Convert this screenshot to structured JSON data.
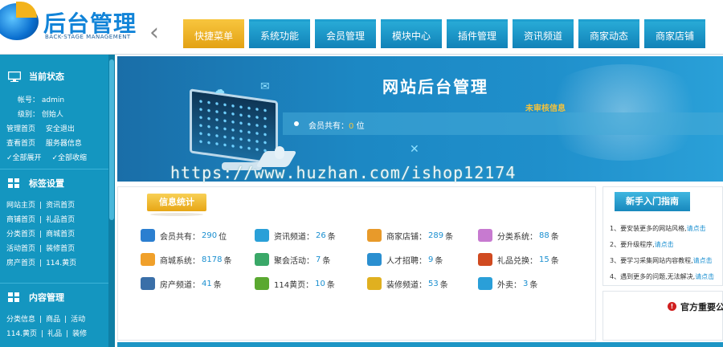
{
  "logo": {
    "title": "后台管理",
    "subtitle": "BACK-STAGE MANAGEMENT"
  },
  "header": {
    "back_glyph": "‹"
  },
  "nav": {
    "tabs": [
      {
        "label": "快捷菜单",
        "active": true
      },
      {
        "label": "系统功能"
      },
      {
        "label": "会员管理"
      },
      {
        "label": "模块中心"
      },
      {
        "label": "插件管理"
      },
      {
        "label": "资讯频道"
      },
      {
        "label": "商家动态"
      },
      {
        "label": "商家店铺"
      }
    ]
  },
  "sidebar": {
    "status": {
      "title": "当前状态",
      "account_label": "帐号：",
      "account": "admin",
      "level_label": "级别：",
      "level": "创始人",
      "links1": [
        "管理首页",
        "安全退出"
      ],
      "links2": [
        "查看首页",
        "服务器信息"
      ],
      "links3": [
        "全部展开",
        "全部收缩"
      ]
    },
    "tags": {
      "title": "标签设置",
      "rows": [
        [
          "网站主页",
          "资讯首页"
        ],
        [
          "商铺首页",
          "礼品首页"
        ],
        [
          "分类首页",
          "商城首页"
        ],
        [
          "活动首页",
          "装修首页"
        ],
        [
          "房产首页",
          "114.黄页"
        ]
      ]
    },
    "content": {
      "title": "内容管理",
      "rows": [
        [
          "分类信息",
          "商品",
          "活动"
        ],
        [
          "114.黄页",
          "礼品",
          "装修"
        ]
      ]
    }
  },
  "banner": {
    "title": "网站后台管理",
    "unaudited": "未审核信息",
    "members_label": "会员共有：",
    "members_value": "0",
    "members_unit": "位"
  },
  "watermark": "https://www.huzhan.com/ishop12174",
  "info": {
    "title": "信息统计",
    "stats": [
      {
        "label": "会员共有：",
        "value": "290",
        "unit": "位",
        "icon": "toggle-icon",
        "color": "#2b7fd0"
      },
      {
        "label": "资讯频道：",
        "value": "26",
        "unit": "条",
        "icon": "globe-icon",
        "color": "#2aa0d8"
      },
      {
        "label": "商家店铺：",
        "value": "289",
        "unit": "条",
        "icon": "book-icon",
        "color": "#e89a2a"
      },
      {
        "label": "分类系统：",
        "value": "88",
        "unit": "条",
        "icon": "flower-icon",
        "color": "#c77ad0"
      },
      {
        "label": "商城系统：",
        "value": "8178",
        "unit": "条",
        "icon": "shop-icon",
        "color": "#f0a02a"
      },
      {
        "label": "聚会活动：",
        "value": "7",
        "unit": "条",
        "icon": "people-icon",
        "color": "#3aa868"
      },
      {
        "label": "人才招聘：",
        "value": "9",
        "unit": "条",
        "icon": "recruit-icon",
        "color": "#2a8fd0"
      },
      {
        "label": "礼品兑换：",
        "value": "15",
        "unit": "条",
        "icon": "gift-icon",
        "color": "#d04a20"
      },
      {
        "label": "房产频道：",
        "value": "41",
        "unit": "条",
        "icon": "building-icon",
        "color": "#3a6fa8"
      },
      {
        "label": "114黄页：",
        "value": "10",
        "unit": "条",
        "icon": "cup-icon",
        "color": "#5aa830"
      },
      {
        "label": "装修频道：",
        "value": "53",
        "unit": "条",
        "icon": "paint-icon",
        "color": "#e0b020"
      },
      {
        "label": "外卖：",
        "value": "3",
        "unit": "条",
        "icon": "refresh-icon",
        "color": "#2a9fd8"
      }
    ]
  },
  "guide": {
    "title": "新手入门指南",
    "lines": [
      {
        "text": "1、要安装更多的网站风格,",
        "link": "请点击"
      },
      {
        "text": "2、要升级程序,",
        "link": "请点击"
      },
      {
        "text": "3、要学习采集网站内容教程,",
        "link": "请点击"
      },
      {
        "text": "4、遇到更多的问题,无法解决,",
        "link": "请点击"
      }
    ]
  },
  "notice": {
    "text": "官方重要公"
  }
}
